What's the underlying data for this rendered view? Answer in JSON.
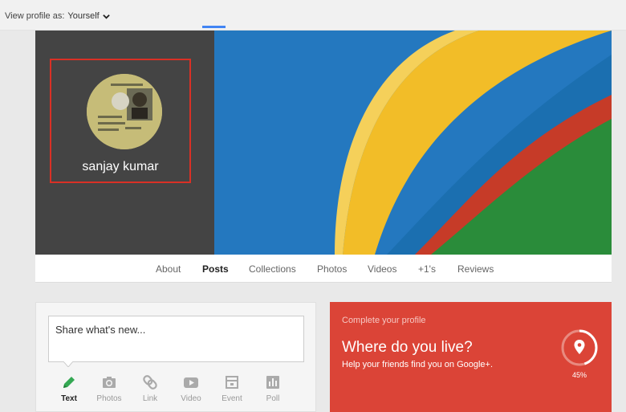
{
  "topbar": {
    "view_label": "View profile as:",
    "view_value": "Yourself"
  },
  "profile": {
    "name": "sanjay kumar"
  },
  "tabs": [
    {
      "label": "About",
      "active": false
    },
    {
      "label": "Posts",
      "active": true
    },
    {
      "label": "Collections",
      "active": false
    },
    {
      "label": "Photos",
      "active": false
    },
    {
      "label": "Videos",
      "active": false
    },
    {
      "label": "+1's",
      "active": false
    },
    {
      "label": "Reviews",
      "active": false
    }
  ],
  "share": {
    "placeholder": "Share what's new...",
    "actions": [
      {
        "label": "Text",
        "icon": "pencil-icon",
        "active": true
      },
      {
        "label": "Photos",
        "icon": "camera-icon",
        "active": false
      },
      {
        "label": "Link",
        "icon": "link-icon",
        "active": false
      },
      {
        "label": "Video",
        "icon": "video-icon",
        "active": false
      },
      {
        "label": "Event",
        "icon": "event-icon",
        "active": false
      },
      {
        "label": "Poll",
        "icon": "poll-icon",
        "active": false
      }
    ]
  },
  "complete_profile": {
    "kicker": "Complete your profile",
    "question": "Where do you live?",
    "subtitle": "Help your friends find you on Google+.",
    "progress_label": "45%",
    "progress": 0.45
  },
  "colors": {
    "accent_blue": "#4285f4",
    "card_red": "#db4437",
    "highlight_border": "#d93025",
    "text_action_green": "#34a853"
  }
}
